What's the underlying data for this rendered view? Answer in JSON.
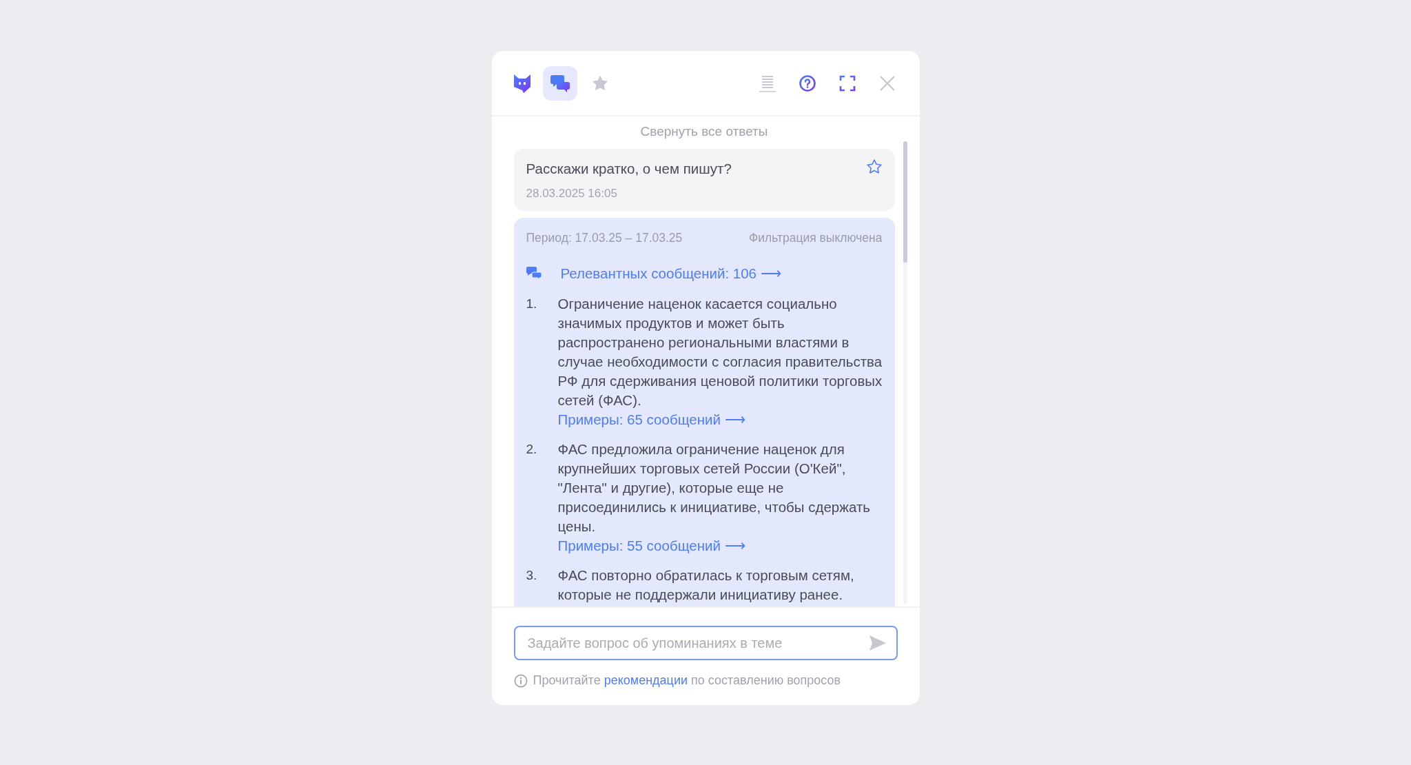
{
  "header": {
    "tabs": [
      {
        "kind": "chat",
        "selected": true
      },
      {
        "kind": "star",
        "selected": false
      }
    ]
  },
  "collapse_all": "Свернуть все ответы",
  "question": {
    "text": "Расскажи кратко, о чем пишут?",
    "date": "28.03.2025 16:05",
    "favorite": false
  },
  "answer": {
    "period": "Период: 17.03.25 – 17.03.25",
    "filter": "Фильтрация выключена",
    "relevant_link": "Релевантных сообщений: 106 ⟶",
    "items": [
      {
        "number": "1.",
        "text": "Ограничение наценок касается социально значимых продуктов и может быть распространено региональными властями в случае необходимости с согласия правительства РФ для сдерживания ценовой политики торговых сетей (ФАС).",
        "link": "Примеры: 65 сообщений ⟶"
      },
      {
        "number": "2.",
        "text": "ФАС предложила ограничение наценок для крупнейших торговых сетей России (О'Кей\", \"Лента\" и другие), которые еще не присоединились к инициативе, чтобы сдержать цены.",
        "link": "Примеры: 55 сообщений ⟶"
      },
      {
        "number": "3.",
        "text": "ФАС повторно обратилась к торговым сетям, которые не поддержали инициативу ранее."
      }
    ]
  },
  "input": {
    "placeholder": "Задайте вопрос об упоминаниях в теме"
  },
  "hint": {
    "before": "Прочитайте",
    "link": "рекомендации",
    "after": "по составлению вопросов"
  }
}
